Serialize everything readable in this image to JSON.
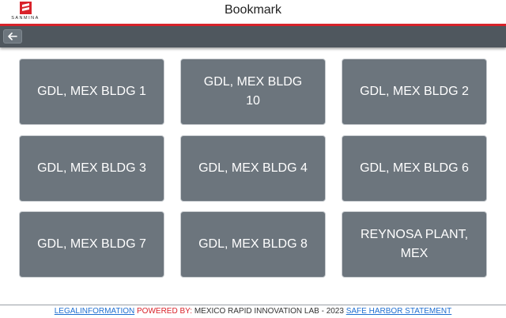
{
  "brand": {
    "name": "SANMINA",
    "accent_color": "#d9222a"
  },
  "header": {
    "title": "Bookmark"
  },
  "toolbar": {
    "back_icon": "arrow-left-icon"
  },
  "bookmarks": [
    {
      "label": "GDL, MEX BLDG 1"
    },
    {
      "label": "GDL, MEX BLDG 10"
    },
    {
      "label": "GDL, MEX BLDG 2"
    },
    {
      "label": "GDL, MEX BLDG 3"
    },
    {
      "label": "GDL, MEX BLDG 4"
    },
    {
      "label": "GDL, MEX BLDG 6"
    },
    {
      "label": "GDL, MEX BLDG 7"
    },
    {
      "label": "GDL, MEX BLDG 8"
    },
    {
      "label": "REYNOSA PLANT, MEX"
    }
  ],
  "footer": {
    "legal_link": "LEGALINFORMATION",
    "powered_by": "POWERED BY:",
    "lab_text": "MEXICO RAPID INNOVATION LAB - 2023",
    "safe_harbor_link": "SAFE HARBOR STATEMENT"
  },
  "colors": {
    "tile_bg": "#6c757d",
    "toolbar_bg": "#4f575e",
    "link": "#1f6fd1"
  }
}
